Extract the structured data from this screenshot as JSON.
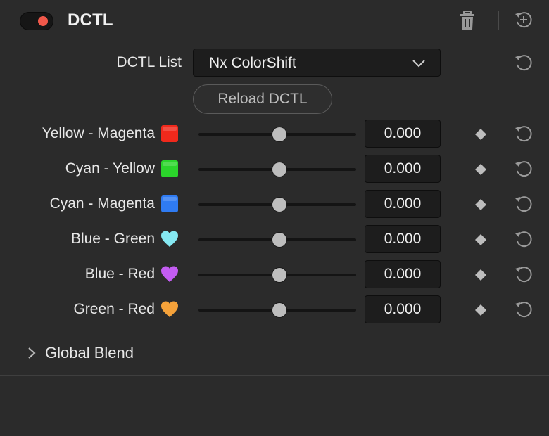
{
  "header": {
    "title": "DCTL",
    "toggle_on": true,
    "toggle_color": "#f0584a"
  },
  "dctl_list": {
    "label": "DCTL List",
    "selected": "Nx ColorShift"
  },
  "reload_label": "Reload DCTL",
  "params": [
    {
      "label": "Yellow - Magenta",
      "swatch": "red-square",
      "value": "0.000",
      "slider": 0.5
    },
    {
      "label": "Cyan - Yellow",
      "swatch": "green-square",
      "value": "0.000",
      "slider": 0.5
    },
    {
      "label": "Cyan - Magenta",
      "swatch": "blue-square",
      "value": "0.000",
      "slider": 0.5
    },
    {
      "label": "Blue - Green",
      "swatch": "light-blue-heart",
      "value": "0.000",
      "slider": 0.5
    },
    {
      "label": "Blue - Red",
      "swatch": "purple-heart",
      "value": "0.000",
      "slider": 0.5
    },
    {
      "label": "Green - Red",
      "swatch": "orange-heart",
      "value": "0.000",
      "slider": 0.5
    }
  ],
  "swatch_colors": {
    "red-square": "#f0291c",
    "green-square": "#2bd42b",
    "blue-square": "#2f7bf2",
    "light-blue-heart": "#86e9f2",
    "purple-heart": "#c35cf2",
    "orange-heart": "#f5a23a"
  },
  "global_blend": {
    "label": "Global Blend",
    "expanded": false
  }
}
